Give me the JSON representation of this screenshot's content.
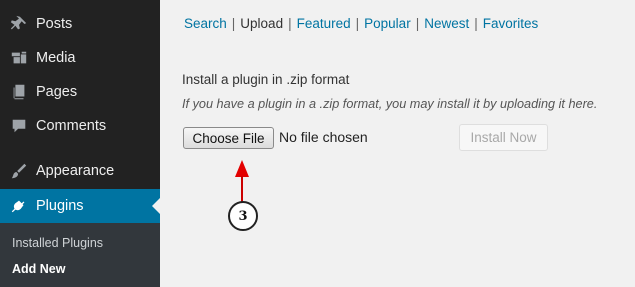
{
  "sidebar": {
    "items": [
      {
        "label": "Posts",
        "icon": "pushpin-icon"
      },
      {
        "label": "Media",
        "icon": "media-icon"
      },
      {
        "label": "Pages",
        "icon": "pages-icon"
      },
      {
        "label": "Comments",
        "icon": "comment-icon"
      },
      {
        "label": "Appearance",
        "icon": "paintbrush-icon"
      },
      {
        "label": "Plugins",
        "icon": "plug-icon",
        "active": true
      }
    ],
    "submenu": [
      {
        "label": "Installed Plugins"
      },
      {
        "label": "Add New",
        "current": true
      }
    ]
  },
  "tabs": [
    {
      "label": "Search"
    },
    {
      "label": "Upload",
      "current": true
    },
    {
      "label": "Featured"
    },
    {
      "label": "Popular"
    },
    {
      "label": "Newest"
    },
    {
      "label": "Favorites"
    }
  ],
  "upload": {
    "heading": "Install a plugin in .zip format",
    "description": "If you have a plugin in a .zip format, you may install it by uploading it here.",
    "choose_file_label": "Choose File",
    "file_status": "No file chosen",
    "install_label": "Install Now"
  },
  "annotation": {
    "number": "3"
  },
  "colors": {
    "sidebar_bg": "#222222",
    "active_bg": "#0074a2",
    "submenu_bg": "#32373c",
    "link": "#0074a2",
    "annotation_arrow": "#e30000",
    "page_bg": "#f1f1f1"
  }
}
